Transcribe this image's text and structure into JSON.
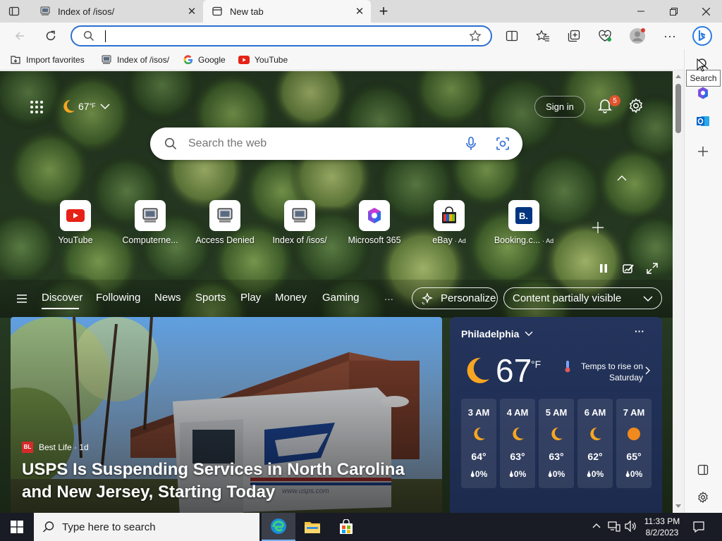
{
  "tabs": [
    {
      "label": "Index of /isos/"
    },
    {
      "label": "New tab"
    }
  ],
  "address": {
    "value": "",
    "placeholder": ""
  },
  "favorites": [
    {
      "label": "Import favorites"
    },
    {
      "label": "Index of /isos/"
    },
    {
      "label": "Google"
    },
    {
      "label": "YouTube"
    }
  ],
  "sidebar": {
    "tooltip": "Search"
  },
  "header": {
    "temperature": "67",
    "temp_unit": "°F",
    "sign_in": "Sign in",
    "notification_count": "5"
  },
  "search": {
    "placeholder": "Search the web"
  },
  "quick_links": [
    {
      "label": "YouTube",
      "ad": ""
    },
    {
      "label": "Computerne...",
      "ad": ""
    },
    {
      "label": "Access Denied",
      "ad": ""
    },
    {
      "label": "Index of /isos/",
      "ad": ""
    },
    {
      "label": "Microsoft 365",
      "ad": ""
    },
    {
      "label": "eBay",
      "ad": "· Ad"
    },
    {
      "label": "Booking.c...",
      "ad": "· Ad"
    }
  ],
  "feed_nav": {
    "items": [
      "Discover",
      "Following",
      "News",
      "Sports",
      "Play",
      "Money",
      "Gaming"
    ],
    "more": "···",
    "personalize": "Personalize",
    "visibility": "Content partially visible"
  },
  "article": {
    "source_badge": "BL",
    "source": "Best Life · 1d",
    "headline": "USPS Is Suspending Services in North Carolina and New Jersey, Starting Today",
    "truck_domain": "www.usps.com"
  },
  "weather": {
    "city": "Philadelphia",
    "temp": "67",
    "unit": "°F",
    "note": "Temps to rise on Saturday",
    "hours": [
      {
        "time": "3 AM",
        "temp": "64°",
        "precip": "0%",
        "icon": "moon-icon"
      },
      {
        "time": "4 AM",
        "temp": "63°",
        "precip": "0%",
        "icon": "moon-icon"
      },
      {
        "time": "5 AM",
        "temp": "63°",
        "precip": "0%",
        "icon": "moon-icon"
      },
      {
        "time": "6 AM",
        "temp": "62°",
        "precip": "0%",
        "icon": "moon-icon"
      },
      {
        "time": "7 AM",
        "temp": "65°",
        "precip": "0%",
        "icon": "sun-icon"
      }
    ]
  },
  "taskbar": {
    "search_placeholder": "Type here to search",
    "time": "11:33 PM",
    "date": "8/2/2023"
  }
}
